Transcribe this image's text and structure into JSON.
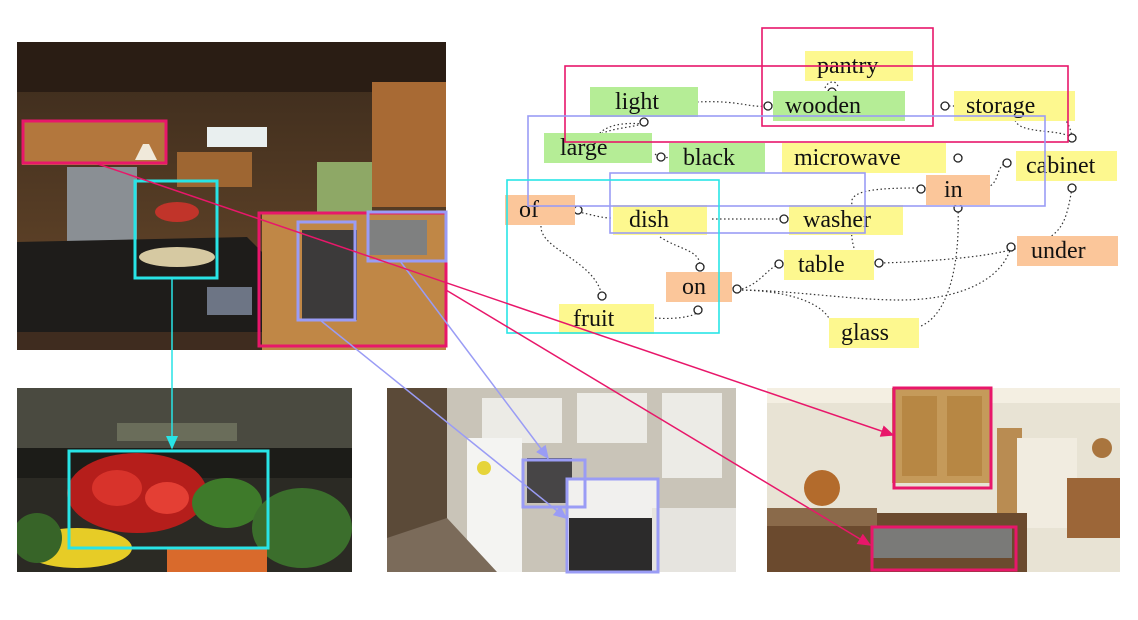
{
  "colors": {
    "object_node": "#fdf88f",
    "attribute_node": "#b5ed96",
    "relation_node": "#fbc69a",
    "pink_box": "#e8176a",
    "purple_box": "#9a9cf5",
    "cyan_box": "#28e4e6"
  },
  "graph": {
    "objects": {
      "pantry": "pantry",
      "storage": "storage",
      "microwave": "microwave",
      "cabinet": "cabinet",
      "dish": "dish",
      "washer": "washer",
      "table": "table",
      "fruit": "fruit",
      "glass": "glass"
    },
    "attributes": {
      "light": "light",
      "wooden": "wooden",
      "large": "large",
      "black": "black"
    },
    "relations": {
      "in": "in",
      "of": "of",
      "under": "under",
      "on": "on"
    }
  },
  "images": [
    {
      "name": "query-kitchen",
      "description": "kitchen scene"
    },
    {
      "name": "retrieved-fruit-bowl",
      "description": "fruit bowl"
    },
    {
      "name": "retrieved-white-kitchen",
      "description": "white kitchen"
    },
    {
      "name": "retrieved-wood-kitchen",
      "description": "wooden kitchen"
    }
  ]
}
